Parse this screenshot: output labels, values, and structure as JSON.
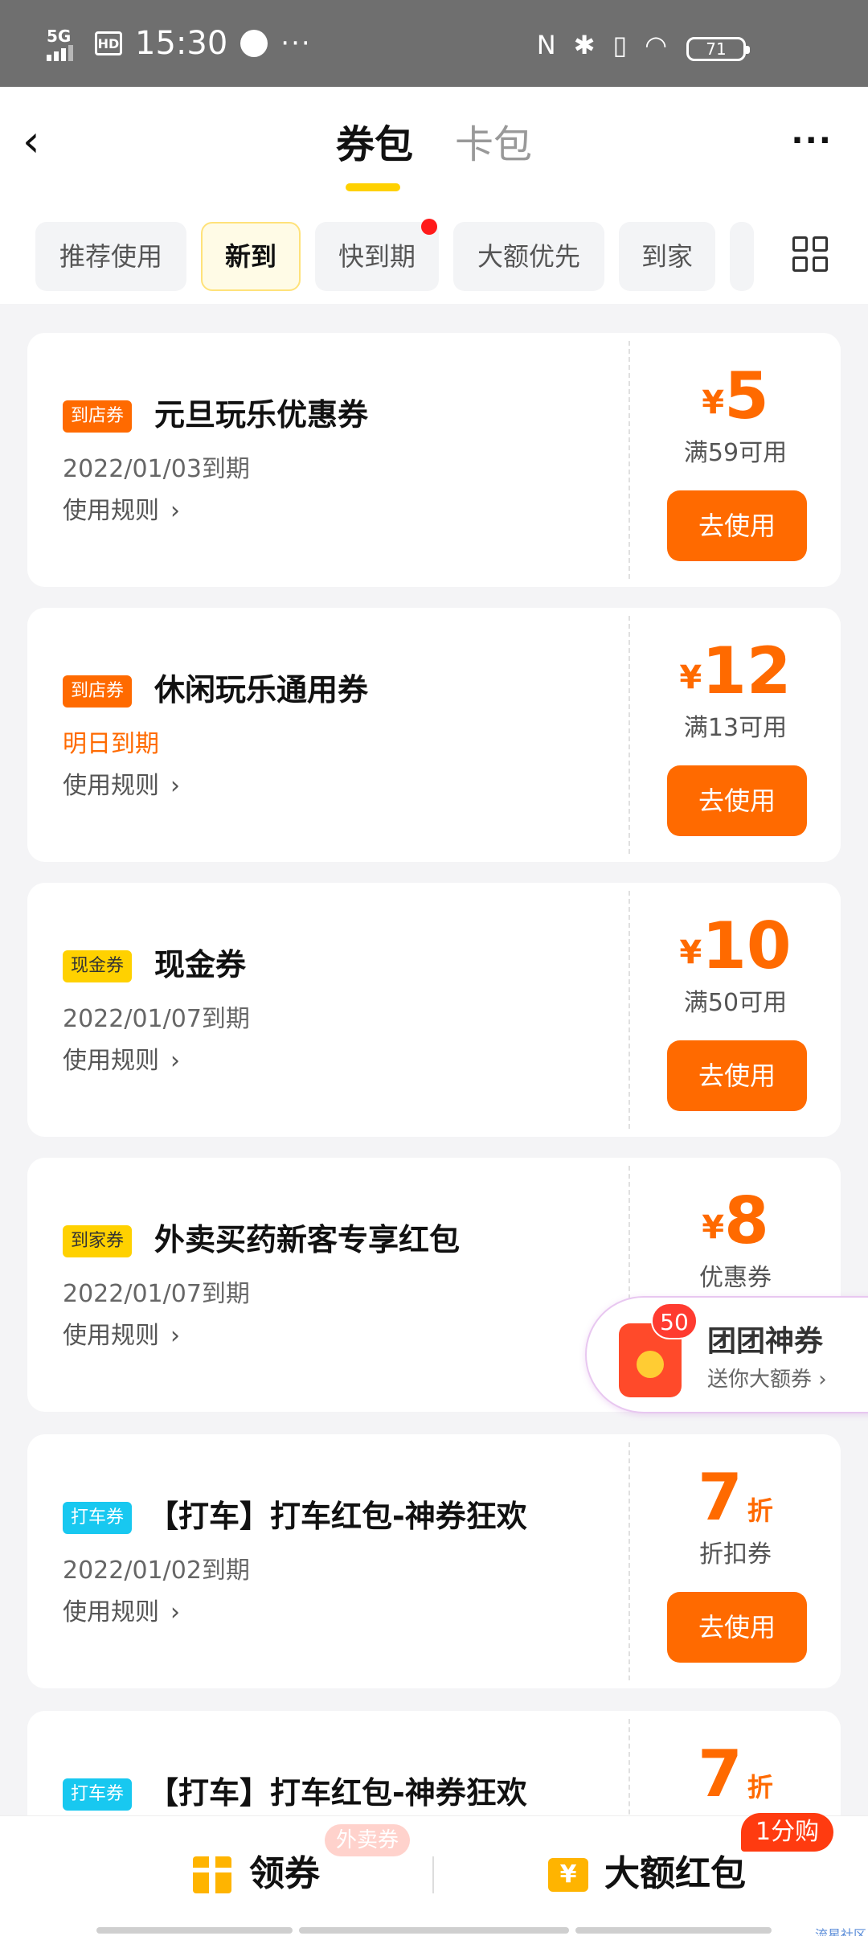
{
  "status_bar": {
    "network": "5G",
    "hd": "HD",
    "time": "15:30",
    "more": "···",
    "nfc": "N",
    "bluetooth": "✱",
    "vibrate": "▯",
    "wifi": "◠",
    "battery": "71"
  },
  "header": {
    "back": "‹",
    "tab_active": "券包",
    "tab_inactive": "卡包",
    "more": "···"
  },
  "filter_chips": [
    "推荐使用",
    "新到",
    "快到期",
    "大额优先",
    "到家"
  ],
  "active_chip": "新到",
  "coupons": [
    {
      "tag": "到店券",
      "title": "元旦玩乐优惠券",
      "date": "2022/01/03到期",
      "rules": "使用规则",
      "currency": "¥",
      "amount": "5",
      "unit": "",
      "condition": "满59可用",
      "button": "去使用"
    },
    {
      "tag": "到店券",
      "title": "休闲玩乐通用券",
      "date": "明日到期",
      "rules": "使用规则",
      "currency": "¥",
      "amount": "12",
      "unit": "",
      "condition": "满13可用",
      "button": "去使用"
    },
    {
      "tag": "现金券",
      "title": "现金券",
      "date": "2022/01/07到期",
      "rules": "使用规则",
      "currency": "¥",
      "amount": "10",
      "unit": "",
      "condition": "满50可用",
      "button": "去使用"
    },
    {
      "tag": "到家券",
      "title": "外卖买药新客专享红包",
      "date": "2022/01/07到期",
      "rules": "使用规则",
      "currency": "¥",
      "amount": "8",
      "unit": "",
      "condition": "优惠券",
      "button": ""
    },
    {
      "tag": "打车券",
      "title": "【打车】打车红包-神券狂欢",
      "date": "2022/01/02到期",
      "rules": "使用规则",
      "currency": "",
      "amount": "7",
      "unit": "折",
      "condition": "折扣券",
      "button": "去使用"
    },
    {
      "tag": "打车券",
      "title": "【打车】打车红包-神券狂欢",
      "date": "",
      "rules": "",
      "currency": "",
      "amount": "7",
      "unit": "折",
      "condition": "",
      "button": ""
    }
  ],
  "promo": {
    "badge": "50",
    "title": "团团神券",
    "subtitle": "送你大额券 ›"
  },
  "bottom_bar": {
    "left_label": "领券",
    "left_pill": "外卖券",
    "right_label": "大额红包",
    "right_pill": "1分购",
    "yen": "¥",
    "watermark": "流星社区"
  },
  "colors": {
    "accent": "#ff6a00",
    "yellow": "#ffd100",
    "cyan": "#18c8f0"
  }
}
